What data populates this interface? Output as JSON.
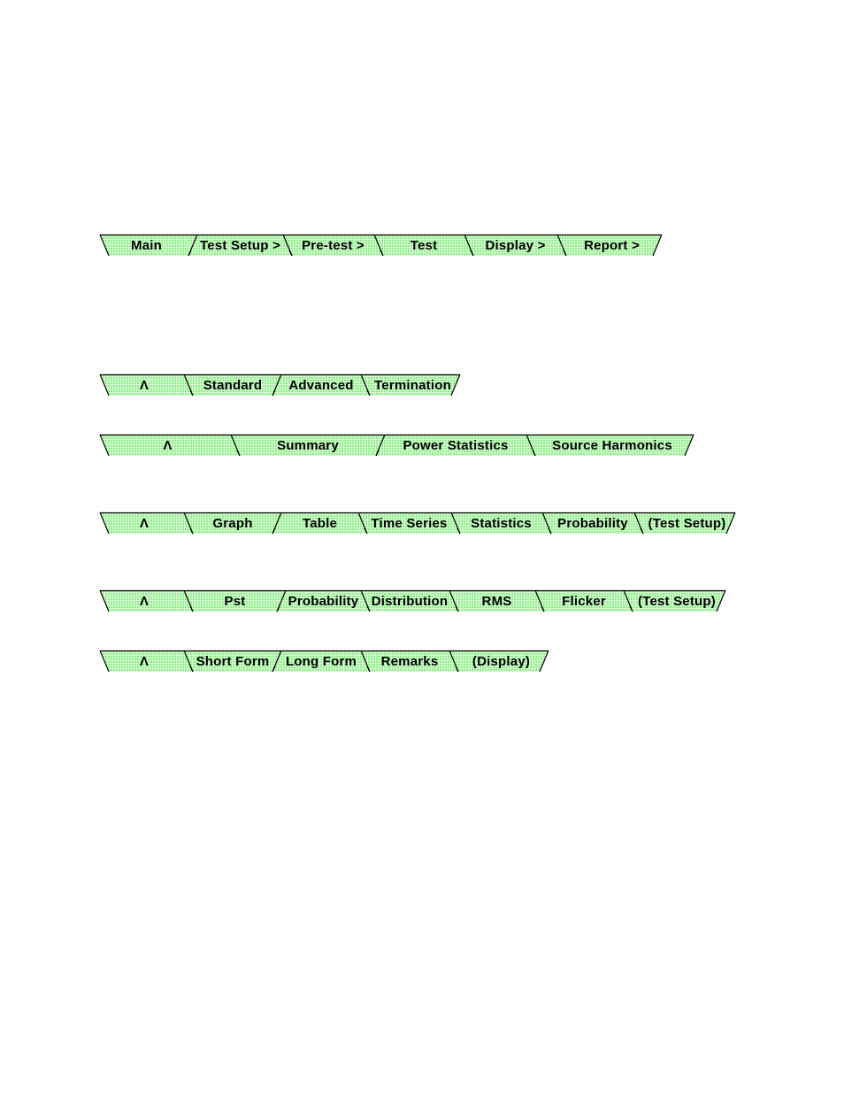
{
  "colors": {
    "fill": "#8ef08a",
    "grid": "#d8f8d4",
    "line": "#000000"
  },
  "tab_bars": [
    {
      "name": "main-menu",
      "tabs": [
        {
          "label": "Main"
        },
        {
          "label": "Test Setup >",
          "sep": "/"
        },
        {
          "label": "Pre-test >",
          "sep": "\\"
        },
        {
          "label": "Test",
          "sep": "\\"
        },
        {
          "label": "Display >",
          "sep": "\\"
        },
        {
          "label": "Report >",
          "sep": "\\"
        }
      ]
    },
    {
      "name": "test-setup-menu",
      "tabs": [
        {
          "label": "Λ"
        },
        {
          "label": "Standard",
          "sep": "\\"
        },
        {
          "label": "Advanced",
          "sep": "/"
        },
        {
          "label": "Termination",
          "sep": "\\"
        }
      ]
    },
    {
      "name": "pre-test-menu",
      "tabs": [
        {
          "label": "Λ"
        },
        {
          "label": "Summary",
          "sep": "\\"
        },
        {
          "label": "Power Statistics",
          "sep": "/"
        },
        {
          "label": "Source Harmonics",
          "sep": "\\"
        }
      ]
    },
    {
      "name": "harmonics-display-menu",
      "tabs": [
        {
          "label": "Λ"
        },
        {
          "label": "Graph",
          "sep": "\\"
        },
        {
          "label": "Table",
          "sep": "/"
        },
        {
          "label": "Time Series",
          "sep": "\\"
        },
        {
          "label": "Statistics",
          "sep": "\\"
        },
        {
          "label": "Probability",
          "sep": "\\"
        },
        {
          "label": "(Test Setup)",
          "sep": "\\"
        }
      ]
    },
    {
      "name": "flicker-display-menu",
      "tabs": [
        {
          "label": "Λ"
        },
        {
          "label": "Pst",
          "sep": "\\"
        },
        {
          "label": "Probability",
          "sep": "/"
        },
        {
          "label": "Distribution",
          "sep": "\\"
        },
        {
          "label": "RMS",
          "sep": "\\"
        },
        {
          "label": "Flicker",
          "sep": "\\"
        },
        {
          "label": "(Test Setup)",
          "sep": "\\"
        }
      ]
    },
    {
      "name": "report-menu",
      "tabs": [
        {
          "label": "Λ"
        },
        {
          "label": "Short Form",
          "sep": "\\"
        },
        {
          "label": "Long Form",
          "sep": "/"
        },
        {
          "label": "Remarks",
          "sep": "\\"
        },
        {
          "label": "(Display)",
          "sep": "\\"
        }
      ]
    }
  ]
}
